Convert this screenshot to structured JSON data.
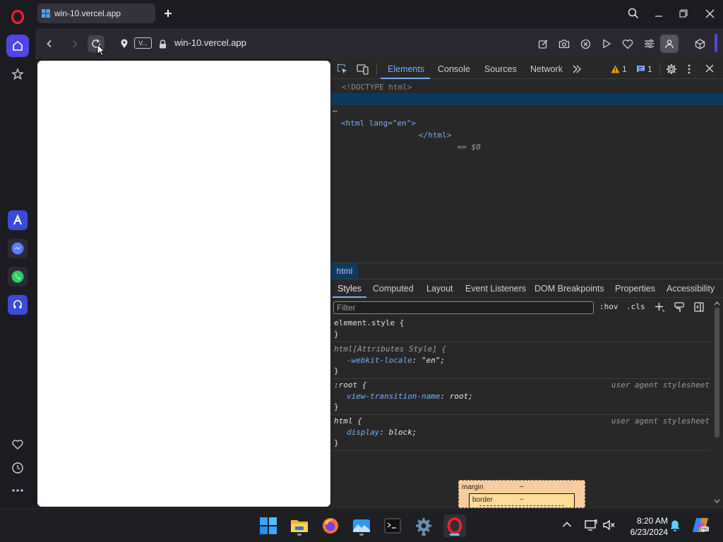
{
  "browser": {
    "tab_title": "win-10.vercel.app",
    "address": "win-10.vercel.app",
    "vpn_label": "V..."
  },
  "devtools": {
    "tabs": [
      "Elements",
      "Console",
      "Sources",
      "Network"
    ],
    "warnings_count": "1",
    "messages_count": "1",
    "dom_lines": {
      "doctype": "<!DOCTYPE html>",
      "html_open": "<html lang=\"en\">",
      "html_close": "</html>",
      "eq": " == $0"
    },
    "breadcrumb": "html",
    "subtabs": [
      "Styles",
      "Computed",
      "Layout",
      "Event Listeners",
      "DOM Breakpoints",
      "Properties",
      "Accessibility"
    ],
    "filter_placeholder": "Filter",
    "hov": ":hov",
    "cls": ".cls",
    "rules": {
      "r1_selector": "element.style {",
      "r2_selector": "html[Attributes Style] {",
      "r2_prop": "-webkit-locale",
      "r2_val": "\"en\";",
      "r3_selector": ":root {",
      "r3_prop": "view-transition-name",
      "r3_val": "root;",
      "r4_selector": "html {",
      "r4_prop": "display",
      "r4_val": "block;",
      "close": "}",
      "source": "user agent stylesheet"
    },
    "boxmodel": {
      "margin_label": "margin",
      "border_label": "border",
      "dash": "–"
    }
  },
  "taskbar": {
    "time": "8:20 AM",
    "date": "6/23/2024"
  },
  "colors": {
    "accent": "#7cacf8",
    "opera_red": "#ff1b2d",
    "sidebar_active": "#5046e5"
  }
}
